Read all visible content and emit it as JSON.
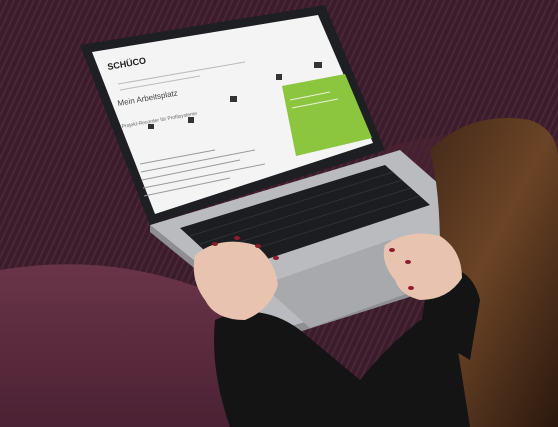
{
  "brand": {
    "logo_text": "SCHÜCO"
  },
  "screen": {
    "heading": "Mein Arbeitsplatz",
    "subheading": "Projekt-Recorder für Profilsysteme",
    "green_panel_title": "",
    "tiles": [
      "",
      "",
      "",
      "",
      ""
    ]
  },
  "colors": {
    "sofa": "#5a2a3c",
    "carpet": "#3b1d2b",
    "laptop_body": "#b7b9bc",
    "keyboard": "#1d1e21",
    "screen_bg": "#f4f4f4",
    "accent_green": "#8cc63f",
    "sweater": "#141414",
    "hair": "#5b3a22"
  }
}
